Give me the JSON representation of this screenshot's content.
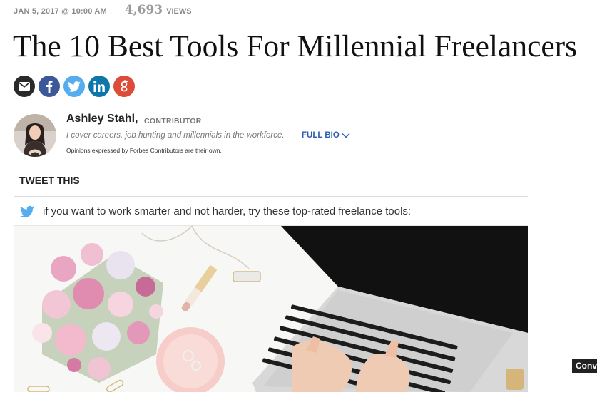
{
  "meta": {
    "date": "JAN 5, 2017 @ 10:00 AM",
    "views_count": "4,693",
    "views_label": "VIEWS"
  },
  "article": {
    "title": "The 10 Best Tools For Millennial Freelancers"
  },
  "share": {
    "icons": [
      "email-icon",
      "facebook-icon",
      "twitter-icon",
      "linkedin-icon",
      "google-plus-icon"
    ]
  },
  "author": {
    "name": "Ashley Stahl,",
    "role": "CONTRIBUTOR",
    "bio": "I cover careers, job hunting and millennials in the workforce.",
    "full_bio_label": "FULL BIO",
    "disclaimer": "Opinions expressed by Forbes Contributors are their own."
  },
  "tweet_this": {
    "heading": "TWEET THIS",
    "text": "if you want to work smarter and not harder, try these top-rated freelance tools:"
  },
  "side_widget": {
    "label": "Conv"
  },
  "colors": {
    "link": "#2a5db0",
    "twitter": "#55acee",
    "facebook": "#3b5998",
    "linkedin": "#0e76a8",
    "google_plus": "#dd4b39"
  }
}
